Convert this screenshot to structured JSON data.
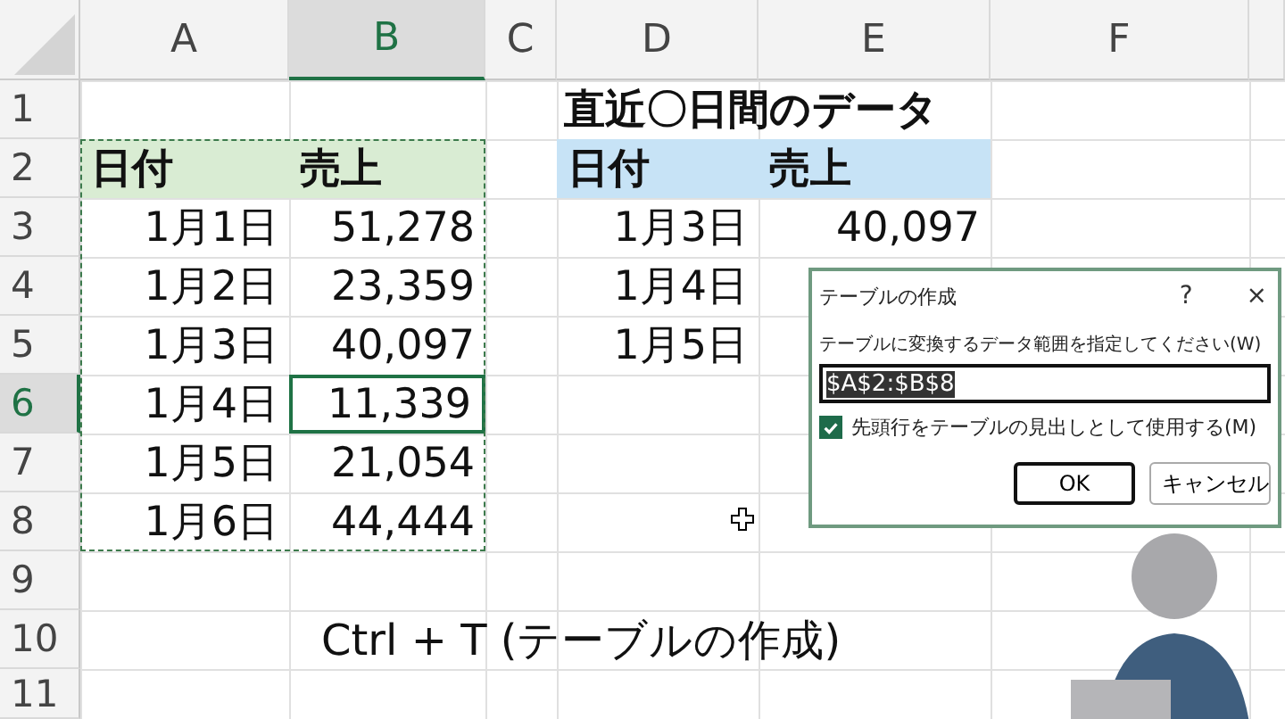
{
  "columns": [
    {
      "label": "A",
      "selected": false
    },
    {
      "label": "B",
      "selected": true
    },
    {
      "label": "C",
      "selected": false
    },
    {
      "label": "D",
      "selected": false
    },
    {
      "label": "E",
      "selected": false
    },
    {
      "label": "F",
      "selected": false
    }
  ],
  "rows": [
    {
      "label": "1",
      "selected": false
    },
    {
      "label": "2",
      "selected": false
    },
    {
      "label": "3",
      "selected": false
    },
    {
      "label": "4",
      "selected": false
    },
    {
      "label": "5",
      "selected": false
    },
    {
      "label": "6",
      "selected": true
    },
    {
      "label": "7",
      "selected": false
    },
    {
      "label": "8",
      "selected": false
    },
    {
      "label": "9",
      "selected": false
    },
    {
      "label": "10",
      "selected": false
    },
    {
      "label": "11",
      "selected": false
    }
  ],
  "left_table": {
    "headers": [
      "日付",
      "売上"
    ],
    "rows": [
      {
        "date": "1月1日",
        "amount": "51,278",
        "selected": false
      },
      {
        "date": "1月2日",
        "amount": "23,359",
        "selected": false
      },
      {
        "date": "1月3日",
        "amount": "40,097",
        "selected": false
      },
      {
        "date": "1月4日",
        "amount": "11,339",
        "selected": true
      },
      {
        "date": "1月5日",
        "amount": "21,054",
        "selected": false
      },
      {
        "date": "1月6日",
        "amount": "44,444",
        "selected": false
      }
    ]
  },
  "right_table": {
    "title": "直近〇日間のデータ",
    "headers": [
      "日付",
      "売上"
    ],
    "rows": [
      {
        "date": "1月3日",
        "amount": "40,097"
      },
      {
        "date": "1月4日"
      },
      {
        "date": "1月5日"
      }
    ]
  },
  "caption": "Ctrl + T (テーブルの作成)",
  "dialog": {
    "title": "テーブルの作成",
    "help": "?",
    "close": "×",
    "range_label": "テーブルに変換するデータ範囲を指定してください(W)",
    "range_value": "$A$2:$B$8",
    "header_checkbox": {
      "label": "先頭行をテーブルの見出しとして使用する(M)",
      "checked": true
    },
    "buttons": [
      {
        "label": "OK",
        "selected": true
      },
      {
        "label": "キャンセル",
        "selected": false
      }
    ]
  }
}
